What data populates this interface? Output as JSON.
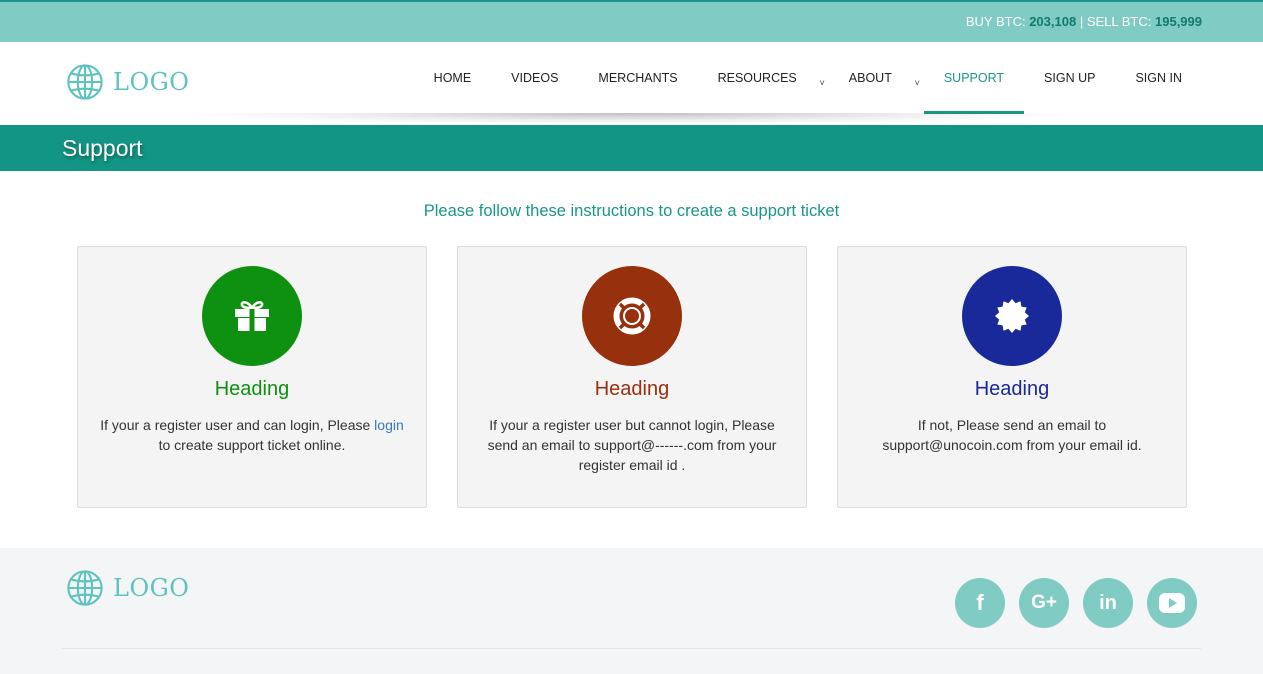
{
  "topbar": {
    "buy_label": "BUY BTC:",
    "buy_value": "203,108",
    "separator": "|",
    "sell_label": "SELL BTC:",
    "sell_value": "195,999"
  },
  "header": {
    "logo_text": "LOGO",
    "nav": [
      {
        "label": "HOME"
      },
      {
        "label": "VIDEOS"
      },
      {
        "label": "MERCHANTS"
      },
      {
        "label": "RESOURCES",
        "caret": "˅"
      },
      {
        "label": "ABOUT",
        "caret": "˅"
      },
      {
        "label": "SUPPORT",
        "active": true
      },
      {
        "label": "SIGN UP"
      },
      {
        "label": "SIGN IN"
      }
    ]
  },
  "page": {
    "title": "Support",
    "instructions": "Please follow these instructions to create a support ticket"
  },
  "cards": [
    {
      "icon": "gift-icon",
      "color": "#0e9110",
      "heading": "Heading",
      "text_before": "If your a register user and can login, Please ",
      "link": "login",
      "text_after": " to create support ticket online."
    },
    {
      "icon": "life-ring-icon",
      "color": "#97300c",
      "heading": "Heading",
      "text": "If your a register user but cannot login, Please send an email to support@------.com from your register email id ."
    },
    {
      "icon": "certificate-icon",
      "color": "#19299a",
      "heading": "Heading",
      "text": "If not, Please send an email to support@unocoin.com from your email id."
    }
  ],
  "footer": {
    "logo_text": "LOGO",
    "social": [
      {
        "icon": "facebook-icon",
        "glyph": "f"
      },
      {
        "icon": "google-plus-icon",
        "glyph": "G+"
      },
      {
        "icon": "linkedin-icon",
        "glyph": "in"
      },
      {
        "icon": "youtube-icon",
        "glyph": ""
      }
    ]
  },
  "colors": {
    "accent": "#1a9688",
    "topbar": "#80cbc4",
    "titlebar": "#129584",
    "link": "#337ab7"
  }
}
